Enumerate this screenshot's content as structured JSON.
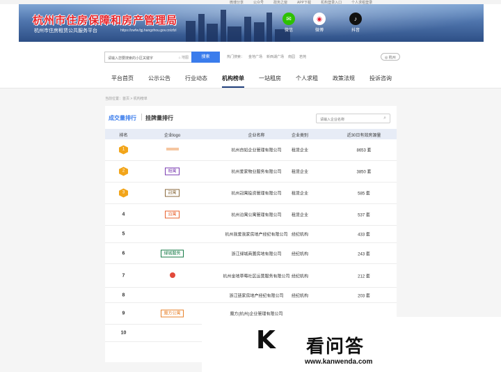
{
  "topbar": {
    "links": [
      "微博分享",
      "公众号",
      "政务之窗",
      "APP下载",
      "机构登录入口",
      "个人求租登录"
    ]
  },
  "banner": {
    "title": "杭州市住房保障和房产管理局",
    "subtitle": "杭州市住房租赁公共服务平台",
    "url": "https://zwfw.fgj.hangzhou.gov.cn/zfzl",
    "social": [
      {
        "label": "微信",
        "icon": "wechat-icon",
        "color": "#2dc100"
      },
      {
        "label": "微博",
        "icon": "weibo-icon",
        "color": "#e6162d"
      },
      {
        "label": "抖音",
        "icon": "douyin-icon",
        "color": "#111111"
      }
    ]
  },
  "search": {
    "placeholder": "请输入您要搜索的小区关键字",
    "map_label": "⌂ 地图",
    "button": "搜索",
    "hot_label": "热门搜索：",
    "hot_items": [
      "金地广场",
      "新西湖广场",
      "南园",
      "若苑"
    ],
    "city": "◎ 杭州"
  },
  "nav": {
    "items": [
      "平台首页",
      "公示公告",
      "行业动态",
      "机构榜单",
      "一站租房",
      "个人求租",
      "政策法规",
      "投诉咨询"
    ],
    "active": 3
  },
  "breadcrumb": "当前位置：首页 > 机构榜单",
  "panel": {
    "tab_deal": "成交量排行",
    "tab_listing": "挂牌量排行",
    "search_placeholder": "请输入企业名称"
  },
  "table": {
    "headers": [
      "排名",
      "企业logo",
      "企业名称",
      "企业类别",
      "近30日有效房源量"
    ],
    "rows": [
      {
        "rank": "1",
        "logo": "",
        "name": "杭州自如企业管理有限公司",
        "type": "租赁企业",
        "count": "8653 套"
      },
      {
        "rank": "2",
        "logo": "相寓",
        "name": "杭州爱家物业服务有限公司",
        "type": "租赁企业",
        "count": "3850 套"
      },
      {
        "rank": "3",
        "logo": "冠寓",
        "name": "杭州冠寓投资管理有限公司",
        "type": "租赁企业",
        "count": "585 套"
      },
      {
        "rank": "4",
        "logo": "泊寓",
        "name": "杭州泊寓公寓管理有限公司",
        "type": "租赁企业",
        "count": "537 套"
      },
      {
        "rank": "5",
        "logo": "",
        "name": "杭州我爱我家房地产经纪有限公司",
        "type": "经纪机构",
        "count": "433 套"
      },
      {
        "rank": "6",
        "logo": "绿城服务",
        "name": "浙江绿城商置房地有限公司",
        "type": "经纪机构",
        "count": "243 套"
      },
      {
        "rank": "7",
        "logo": "",
        "name": "杭州金地草莓社区运营服务有限公司",
        "type": "经纪机构",
        "count": "212 套"
      },
      {
        "rank": "8",
        "logo": "",
        "name": "浙江链家房地产经纪有限公司",
        "type": "经纪机构",
        "count": "203 套"
      },
      {
        "rank": "9",
        "logo": "魔方公寓",
        "name": "魔方(杭州)企业管理有限公司",
        "type": "",
        "count": ""
      },
      {
        "rank": "10",
        "logo": "",
        "name": "",
        "type": "",
        "count": ""
      }
    ]
  },
  "watermark": {
    "brand": "看问答",
    "url": "www.kanwenda.com"
  }
}
